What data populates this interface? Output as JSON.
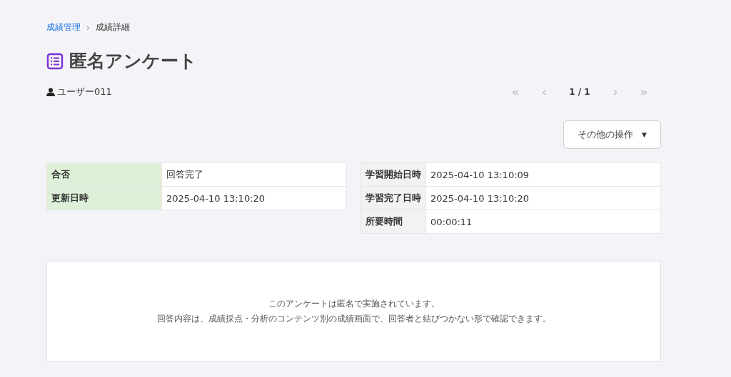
{
  "breadcrumb": [
    {
      "label": "成績管理",
      "link": true
    },
    {
      "label": "成績詳細",
      "link": false
    }
  ],
  "breadcrumb_separator": "›",
  "title": "匿名アンケート",
  "user": "ユーザー011",
  "pager": {
    "first": {
      "label": "«",
      "disabled": true
    },
    "prev": {
      "label": "‹",
      "disabled": true
    },
    "page": "1 / 1",
    "next": {
      "label": "›",
      "disabled": true
    },
    "last": {
      "label": "»",
      "disabled": true
    }
  },
  "actions_button": {
    "label": "その他の操作",
    "caret": "▼"
  },
  "tables": [
    {
      "color": "#dff0d8",
      "rows": [
        {
          "label": "合否",
          "value": "回答完了"
        },
        {
          "label": "更新日時",
          "value": "2025-04-10 13:10:20"
        }
      ]
    },
    {
      "color": "#f2f2f2",
      "rows": [
        {
          "label": "学習開始日時",
          "value": "2025-04-10 13:10:09"
        },
        {
          "label": "学習完了日時",
          "value": "2025-04-10 13:10:20"
        },
        {
          "label": "所要時間",
          "value": "00:00:11"
        }
      ]
    }
  ],
  "notice": [
    "このアンケートは匿名で実施されています。",
    "回答内容は、成績採点・分析のコンテンツ別の成績画面で、回答者と結びつかない形で確認できます。"
  ]
}
